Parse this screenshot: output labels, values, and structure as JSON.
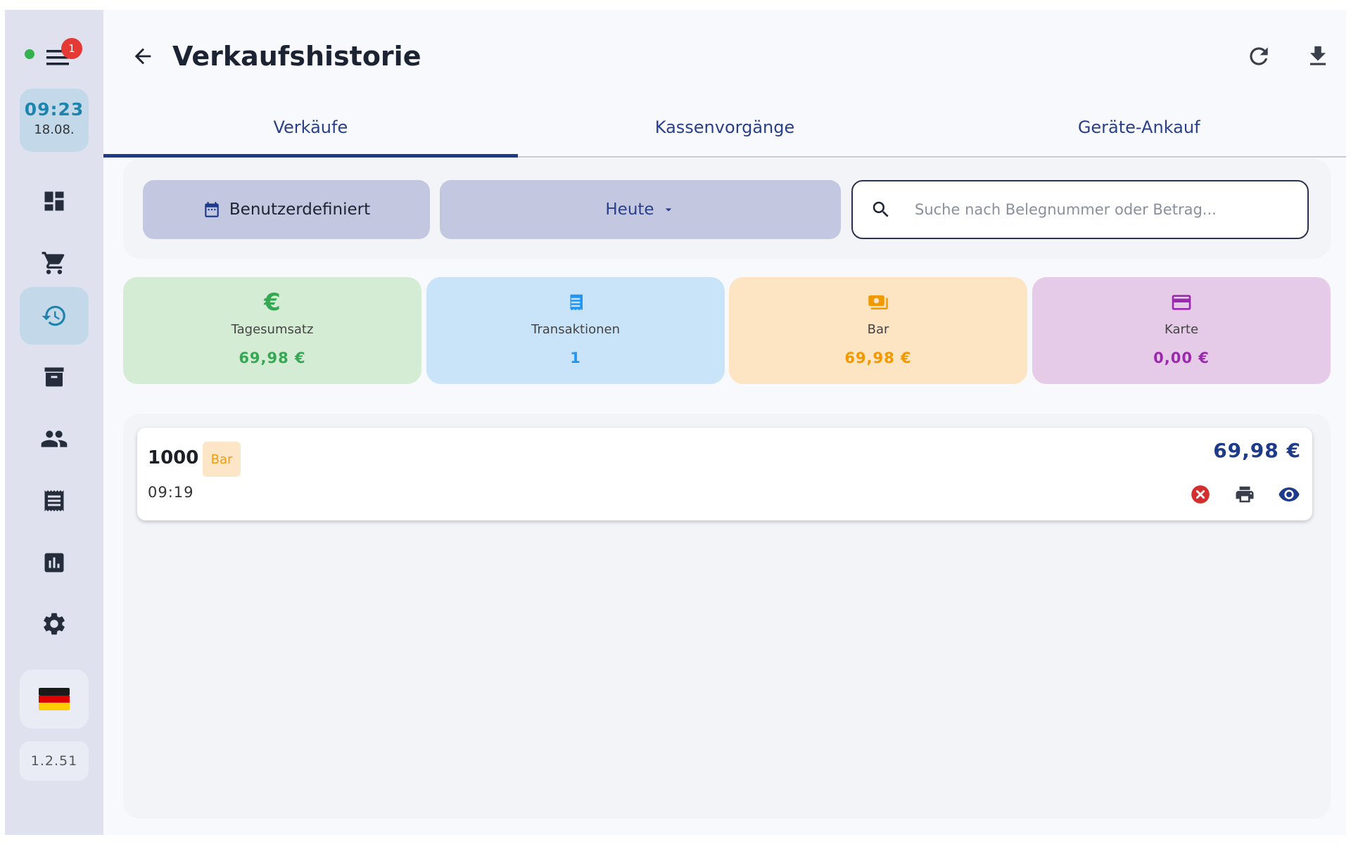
{
  "sidebar": {
    "notification_count": "1",
    "clock": {
      "time": "09:23",
      "date": "18.08."
    },
    "nav_items": [
      {
        "name": "dashboard",
        "icon": "dashboard-icon"
      },
      {
        "name": "cart",
        "icon": "cart-icon"
      },
      {
        "name": "sales-history",
        "icon": "history-icon",
        "active": true
      },
      {
        "name": "inventory",
        "icon": "archive-icon"
      },
      {
        "name": "customers",
        "icon": "people-icon"
      },
      {
        "name": "receipts",
        "icon": "receipt-icon"
      },
      {
        "name": "reports",
        "icon": "bar-chart-icon"
      },
      {
        "name": "settings",
        "icon": "gear-icon"
      }
    ],
    "language_flag": "de-flag-icon",
    "version": "1.2.51"
  },
  "header": {
    "title": "Verkaufshistorie"
  },
  "tabs": [
    {
      "label": "Verkäufe",
      "active": true
    },
    {
      "label": "Kassenvorgänge",
      "active": false
    },
    {
      "label": "Geräte-Ankauf",
      "active": false
    }
  ],
  "filters": {
    "date_range_label": "Benutzerdefiniert",
    "period_selected": "Heute",
    "search_value": "",
    "search_placeholder": "Suche nach Belegnummer oder Betrag..."
  },
  "summary": {
    "revenue": {
      "label": "Tagesumsatz",
      "value": "69,98 €"
    },
    "transactions": {
      "label": "Transaktionen",
      "value": "1"
    },
    "cash": {
      "label": "Bar",
      "value": "69,98 €"
    },
    "card": {
      "label": "Karte",
      "value": "0,00 €"
    }
  },
  "transactions": [
    {
      "id": "1000",
      "payment_badge": "Bar",
      "time": "09:19",
      "amount": "69,98 €"
    }
  ],
  "colors": {
    "primary": "#1e3a8a",
    "sidebar_bg": "#dfe2ee",
    "active_nav": "#c3d9ea",
    "revenue_green": "#34a853",
    "transactions_blue": "#2196f3",
    "cash_orange": "#f29900",
    "card_purple": "#9c27b0",
    "cancel_red": "#d32f2f"
  }
}
